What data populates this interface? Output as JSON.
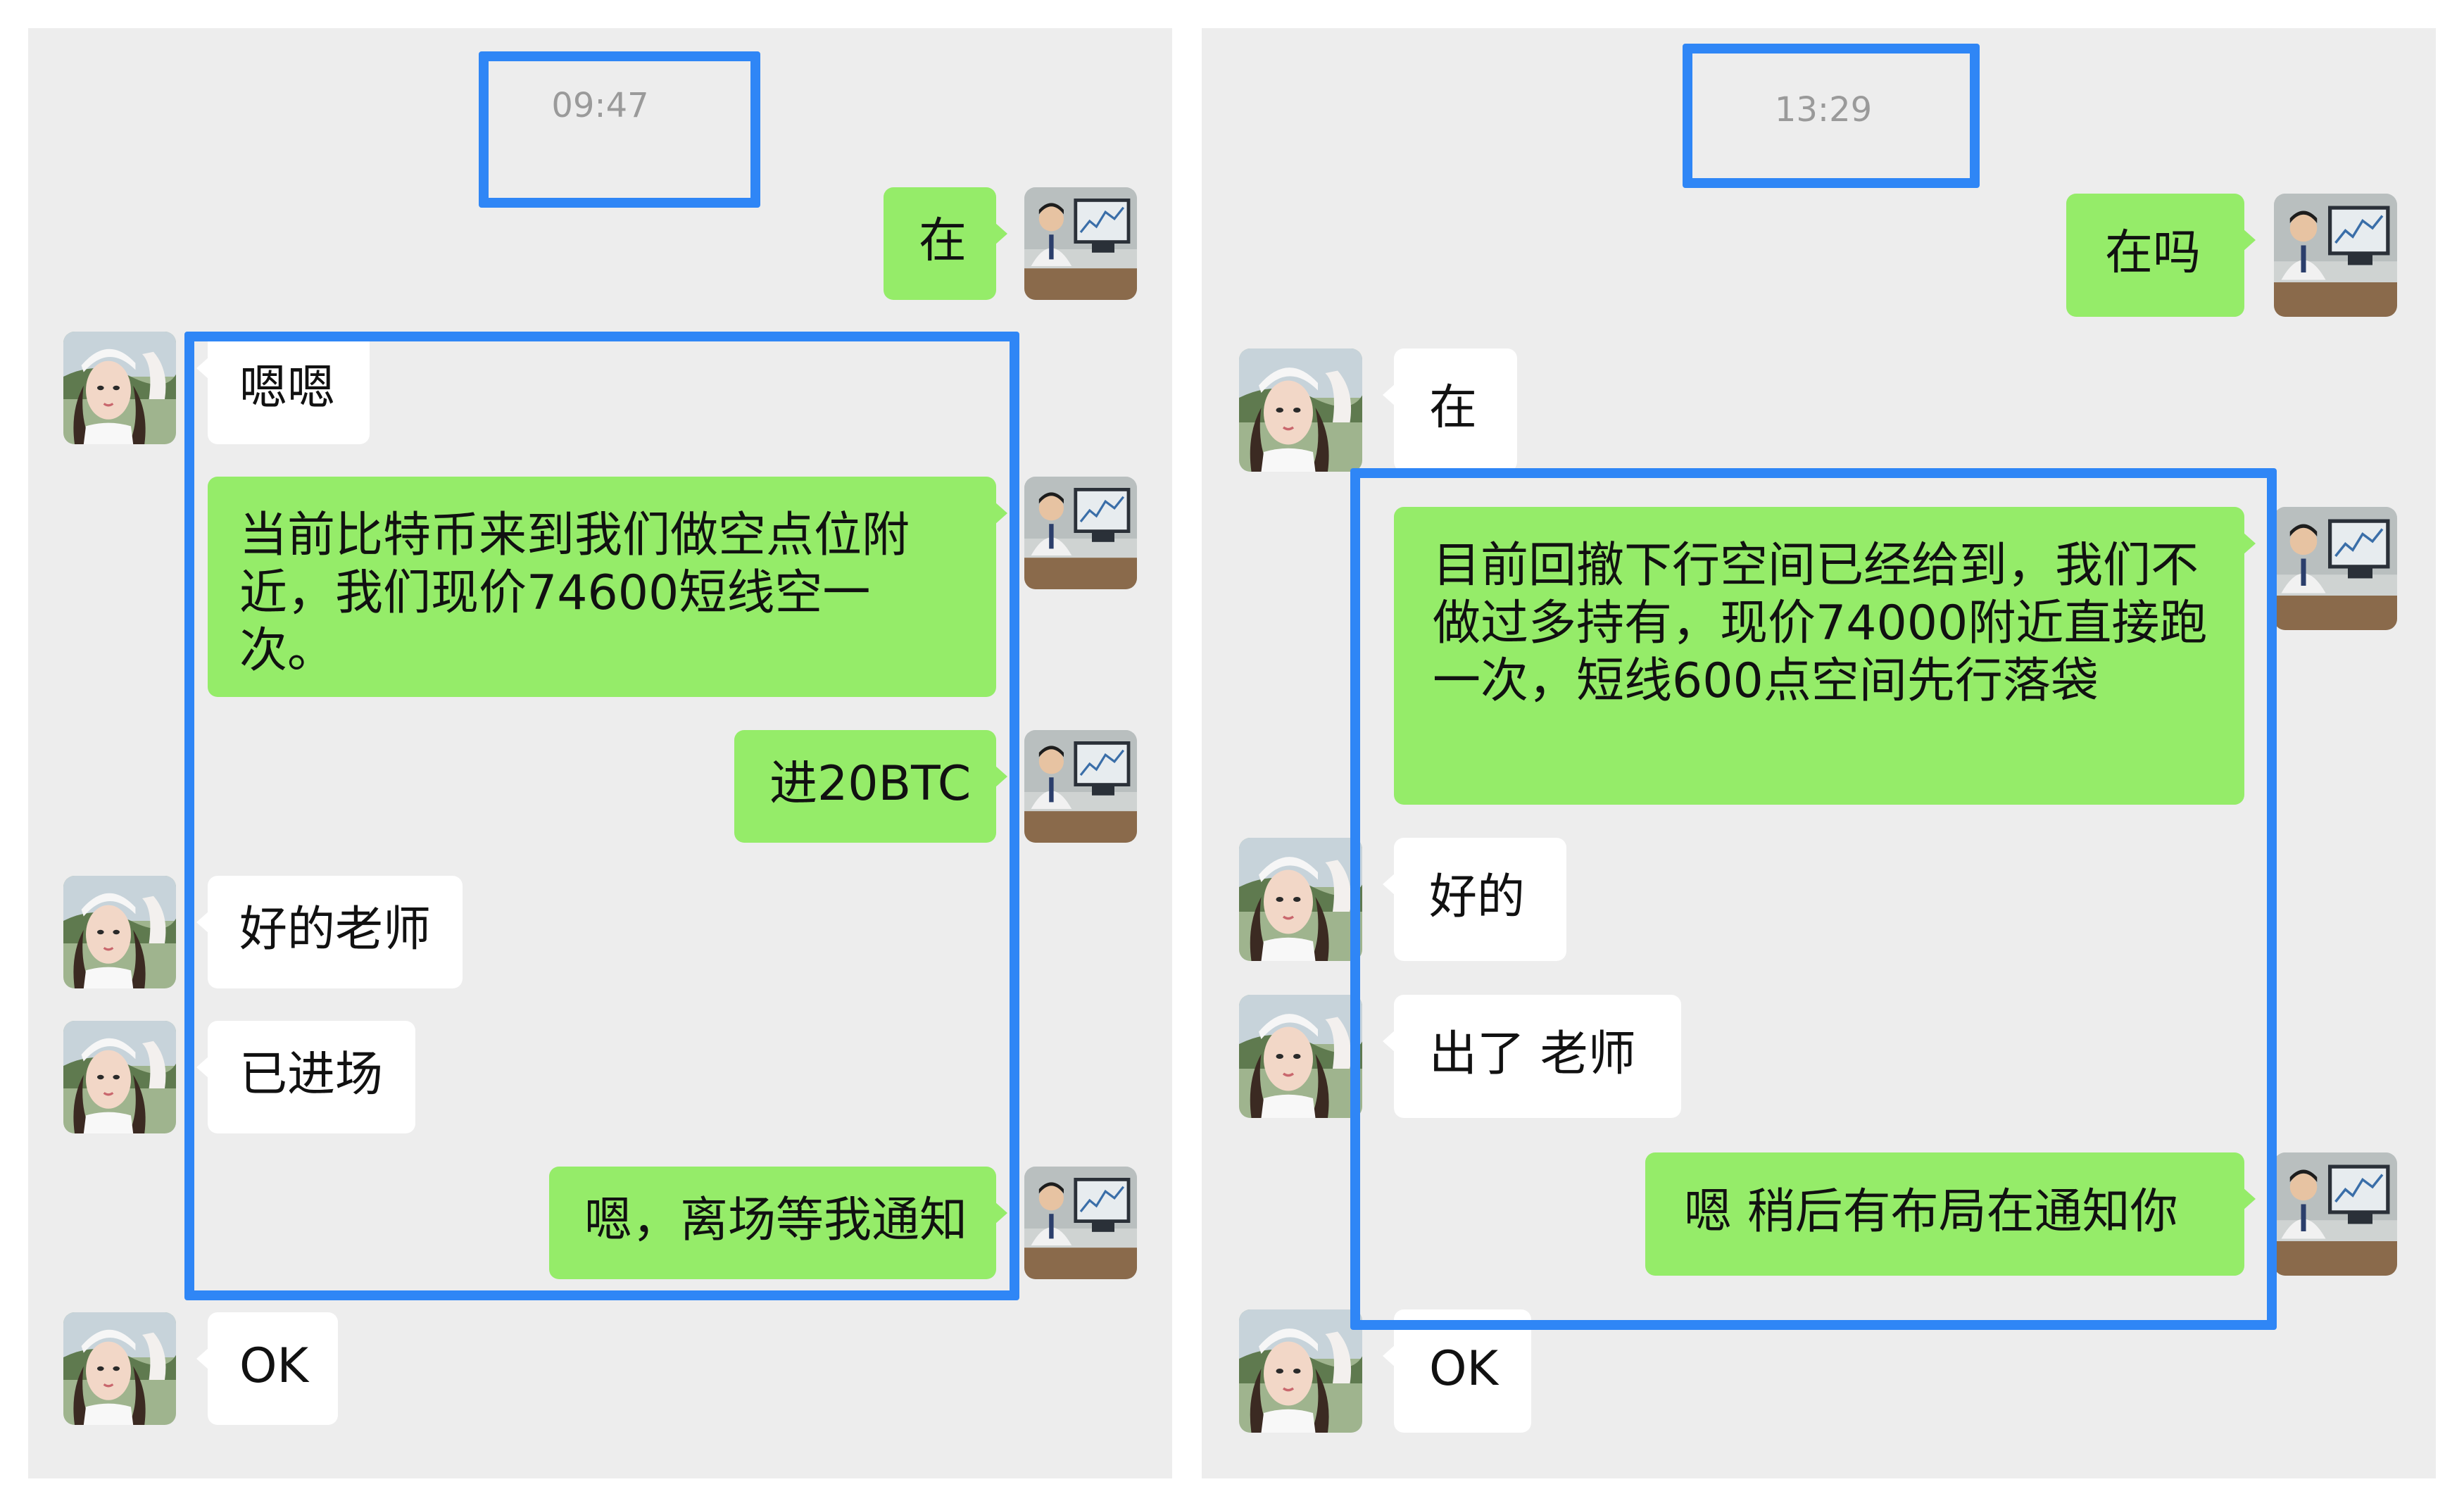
{
  "colors": {
    "panel_bg": "#ededed",
    "my_bubble": "#95ec69",
    "their_bubble": "#ffffff",
    "highlight_box": "#2f86f6"
  },
  "left_chat": {
    "timestamp": "09:47",
    "messages": [
      {
        "sender": "me",
        "text": "在"
      },
      {
        "sender": "them",
        "text": "嗯嗯"
      },
      {
        "sender": "me",
        "text": "当前比特币来到我们做空点位附近，我们现价74600短线空一次。"
      },
      {
        "sender": "me",
        "text": "进20BTC"
      },
      {
        "sender": "them",
        "text": "好的老师"
      },
      {
        "sender": "them",
        "text": "已进场"
      },
      {
        "sender": "me",
        "text": "嗯，离场等我通知"
      },
      {
        "sender": "them",
        "text": "OK"
      }
    ]
  },
  "right_chat": {
    "timestamp": "13:29",
    "messages": [
      {
        "sender": "me",
        "text": "在吗"
      },
      {
        "sender": "them",
        "text": "在"
      },
      {
        "sender": "me",
        "text": "目前回撤下行空间已经给到，我们不做过多持有，现价74000附近直接跑一次，短线600点空间先行落袋"
      },
      {
        "sender": "them",
        "text": "好的"
      },
      {
        "sender": "them",
        "text": "出了 老师"
      },
      {
        "sender": "me",
        "text": "嗯 稍后有布局在通知你"
      },
      {
        "sender": "them",
        "text": "OK"
      }
    ]
  }
}
